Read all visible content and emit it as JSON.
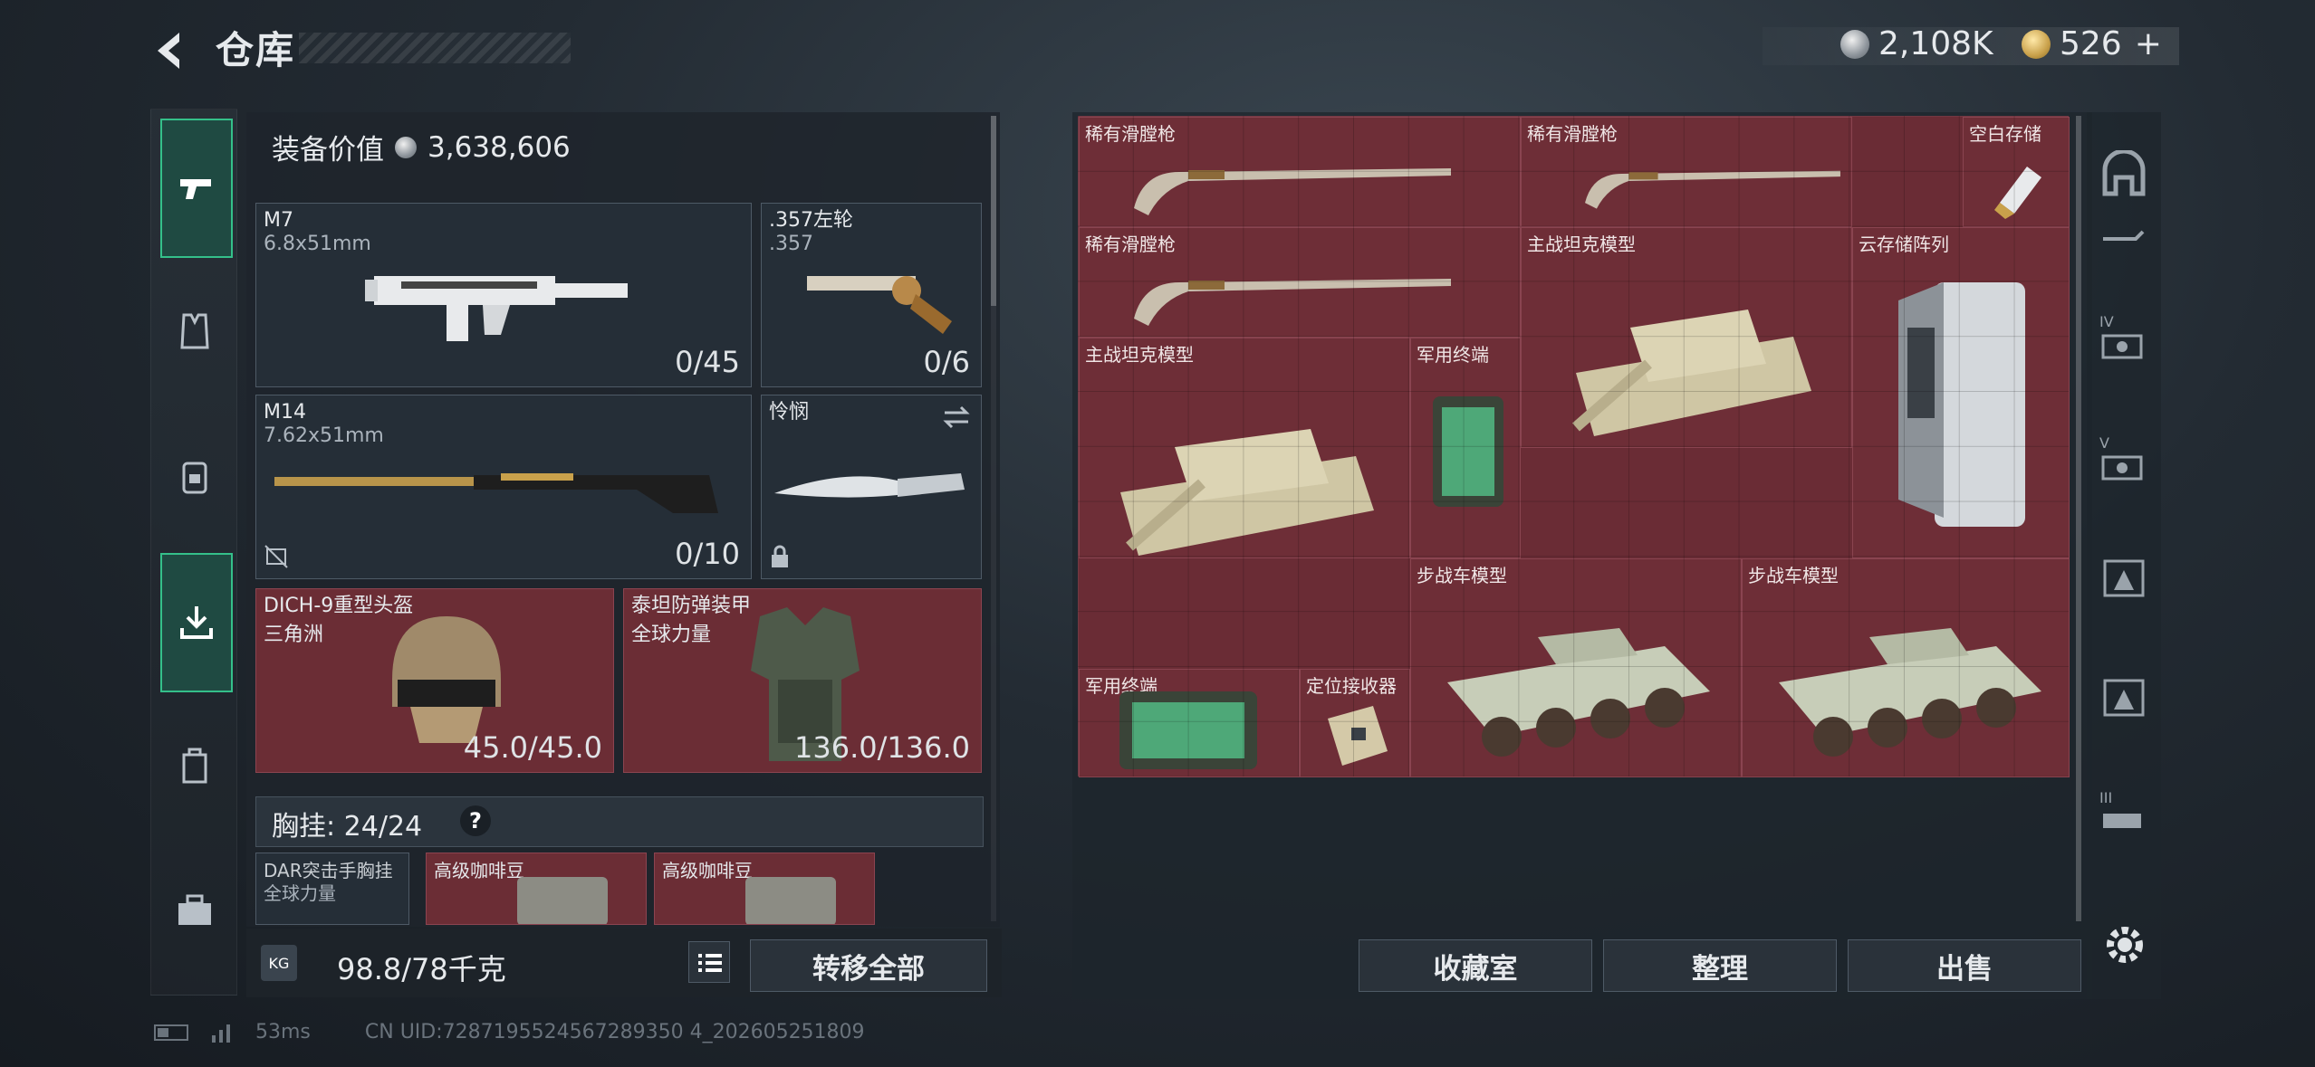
{
  "header": {
    "title": "仓库"
  },
  "currency": {
    "silver": "2,108K",
    "gold": "526",
    "gold_add": "+"
  },
  "equipment": {
    "value_label": "装备价值",
    "value": "3,638,606",
    "primary": {
      "name": "M7",
      "caliber": "6.8x51mm",
      "ammo": "0/45"
    },
    "sidearm": {
      "name": ".357左轮",
      "caliber": ".357",
      "ammo": "0/6"
    },
    "secondary": {
      "name": "M14",
      "caliber": "7.62x51mm",
      "ammo": "0/10"
    },
    "melee": {
      "name": "怜悯"
    },
    "helmet": {
      "name": "DICH-9重型头盔",
      "origin": "三角洲",
      "durability": "45.0/45.0"
    },
    "armor": {
      "name": "泰坦防弹装甲",
      "origin": "全球力量",
      "durability": "136.0/136.0"
    },
    "chest": {
      "label": "胸挂:",
      "capacity": "24/24",
      "help": "?"
    },
    "chest_items": [
      {
        "name": "DAR突击手胸挂",
        "sub": "全球力量"
      },
      {
        "name": "高级咖啡豆"
      },
      {
        "name": "高级咖啡豆"
      }
    ],
    "weight": "98.8/78千克",
    "weight_unit": "KG",
    "transfer_label": "转移全部"
  },
  "storage": {
    "items": [
      {
        "name": "稀有滑膛枪"
      },
      {
        "name": "稀有滑膛枪"
      },
      {
        "name": "空白存储"
      },
      {
        "name": "稀有滑膛枪"
      },
      {
        "name": "主战坦克模型"
      },
      {
        "name": "云存储阵列"
      },
      {
        "name": "主战坦克模型"
      },
      {
        "name": "军用终端"
      },
      {
        "name": "步战车模型"
      },
      {
        "name": "步战车模型"
      },
      {
        "name": "军用终端"
      },
      {
        "name": "定位接收器"
      }
    ],
    "actions": {
      "collection": "收藏室",
      "sort": "整理",
      "sell": "出售"
    }
  },
  "right_tabs": [
    "IV",
    "V",
    "III"
  ],
  "footer": {
    "ping": "53ms",
    "uid": "CN UID:7287195524567289350 4_202605251809"
  },
  "colors": {
    "accent": "#34c08a",
    "item_bg": "#6b2d35",
    "panel": "#252e37"
  }
}
